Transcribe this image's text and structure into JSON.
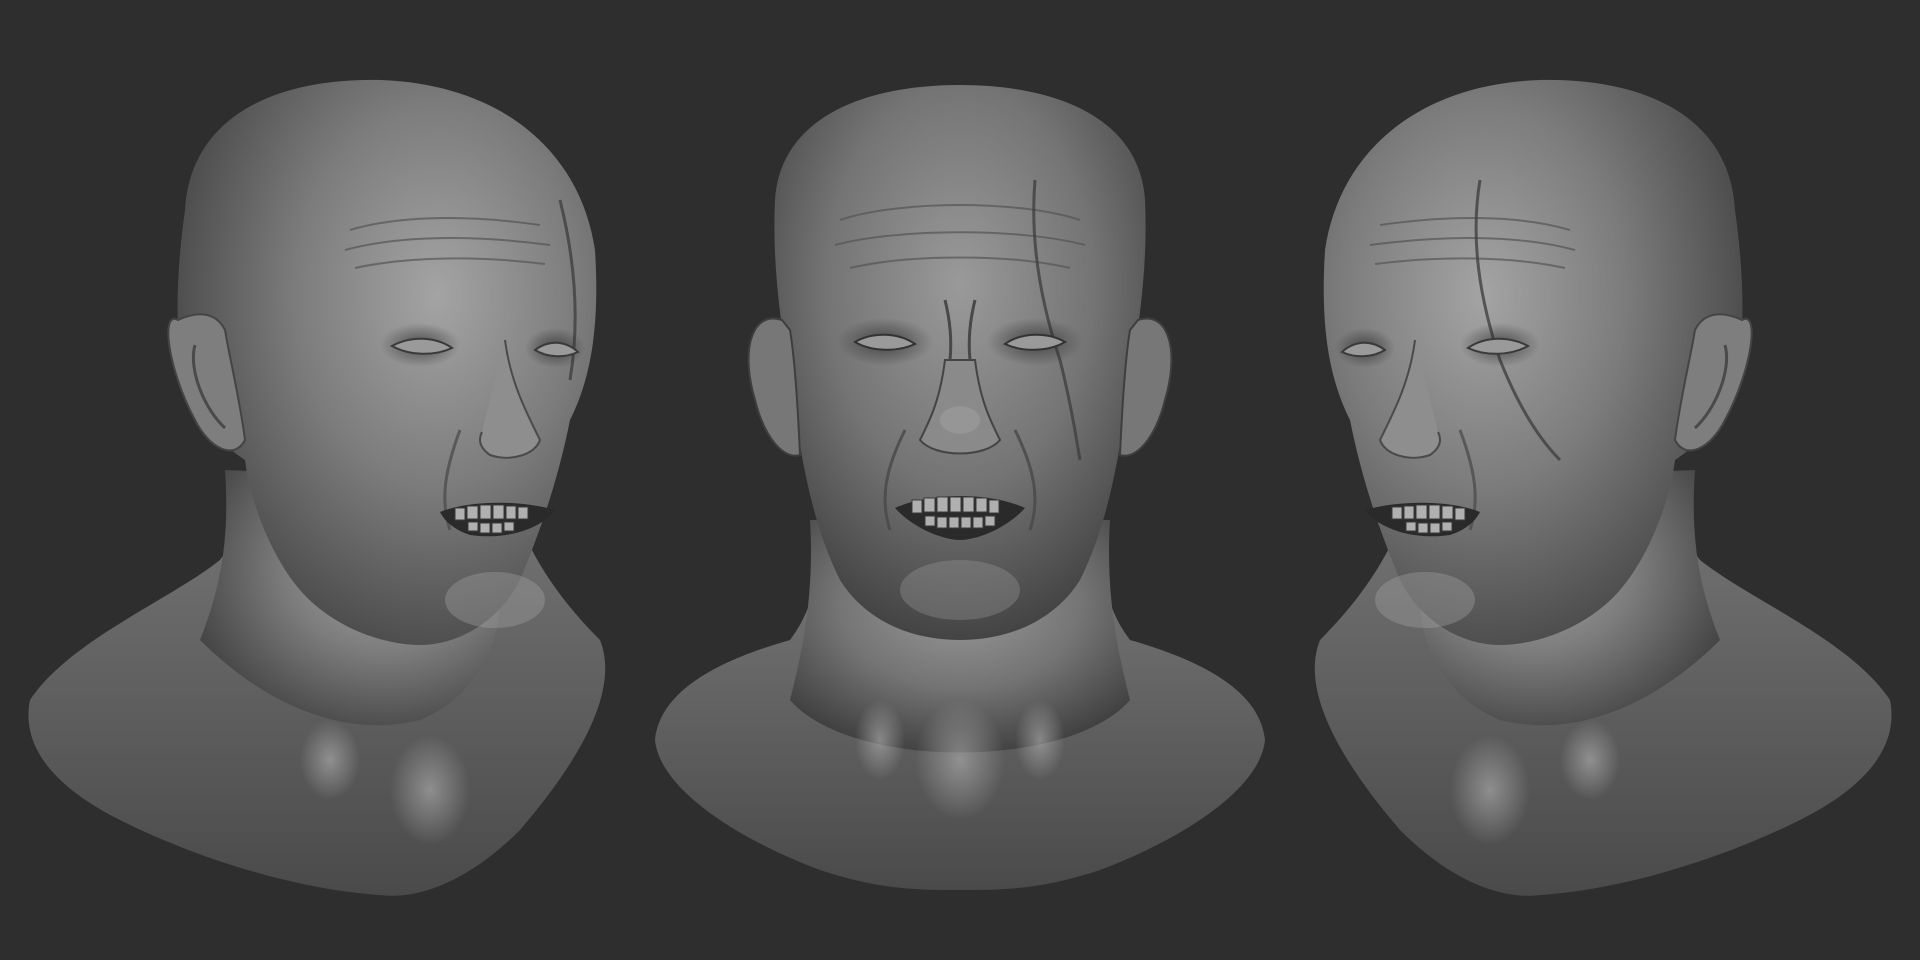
{
  "scene": {
    "background_color": "#2e2e2e",
    "material_color": "#8a8a8a",
    "views": [
      {
        "view": "three-quarter-left",
        "expression": "snarl"
      },
      {
        "view": "front",
        "expression": "snarl"
      },
      {
        "view": "three-quarter-right",
        "expression": "snarl"
      }
    ]
  }
}
